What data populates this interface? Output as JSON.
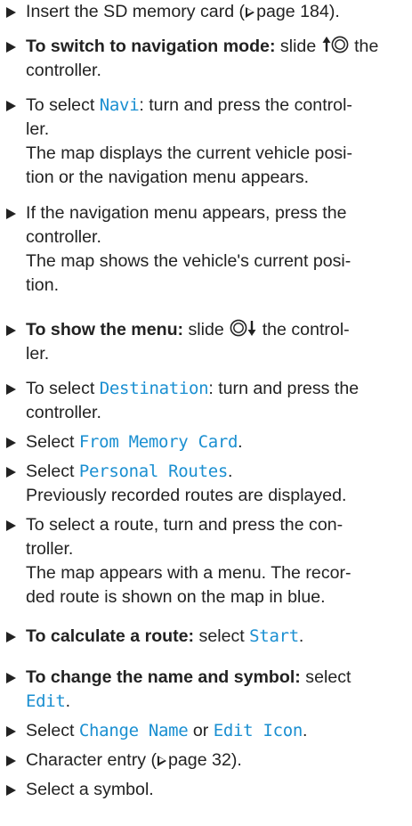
{
  "steps": [
    {
      "pre": "Insert the SD memory card (",
      "ref": "page 184",
      "post": ")."
    },
    {
      "bold": "To switch to navigation mode:",
      "pre": " slide ",
      "post": " the controller."
    },
    {
      "pre": "To select ",
      "kw": "Navi",
      "post": ": turn and press the control-",
      "post2": "ler.",
      "result": "The map displays the current vehicle posi-",
      "result2": "tion or the navigation menu appears."
    },
    {
      "pre": "If the navigation menu appears, press the",
      "post": "controller.",
      "result": "The map shows the vehicle's current posi-",
      "result2": "tion."
    },
    {
      "bold": "To show the menu:",
      "pre": " slide ",
      "post": " the control-",
      "post2": "ler."
    },
    {
      "pre": "To select ",
      "kw": "Destination",
      "post": ": turn and press the",
      "post2": "controller."
    },
    {
      "pre": "Select ",
      "kw": "From Memory Card",
      "post": "."
    },
    {
      "pre": "Select ",
      "kw": "Personal Routes",
      "post": ".",
      "result": "Previously recorded routes are displayed."
    },
    {
      "pre": "To select a route, turn and press the con-",
      "post": "troller.",
      "result": "The map appears with a menu. The recor-",
      "result2": "ded route is shown on the map in blue."
    },
    {
      "bold": "To calculate a route:",
      "pre": " select ",
      "kw": "Start",
      "post": "."
    },
    {
      "bold": "To change the name and symbol:",
      "pre": " select",
      "kw": "Edit",
      "post": "."
    },
    {
      "pre": "Select ",
      "kw": "Change Name",
      "mid": " or ",
      "kw2": "Edit Icon",
      "post": "."
    },
    {
      "pre": "Character entry (",
      "ref": "page 32",
      "post": ")."
    },
    {
      "pre": "Select a symbol."
    }
  ],
  "colors": {
    "keyword": "#1a8fd1",
    "text": "#222222"
  },
  "icons": {
    "bullet": "triangle-right-bullet",
    "ref": "outlined-triangle-reference",
    "controller_up": "controller-slide-up-icon",
    "controller_down": "controller-slide-down-icon"
  }
}
